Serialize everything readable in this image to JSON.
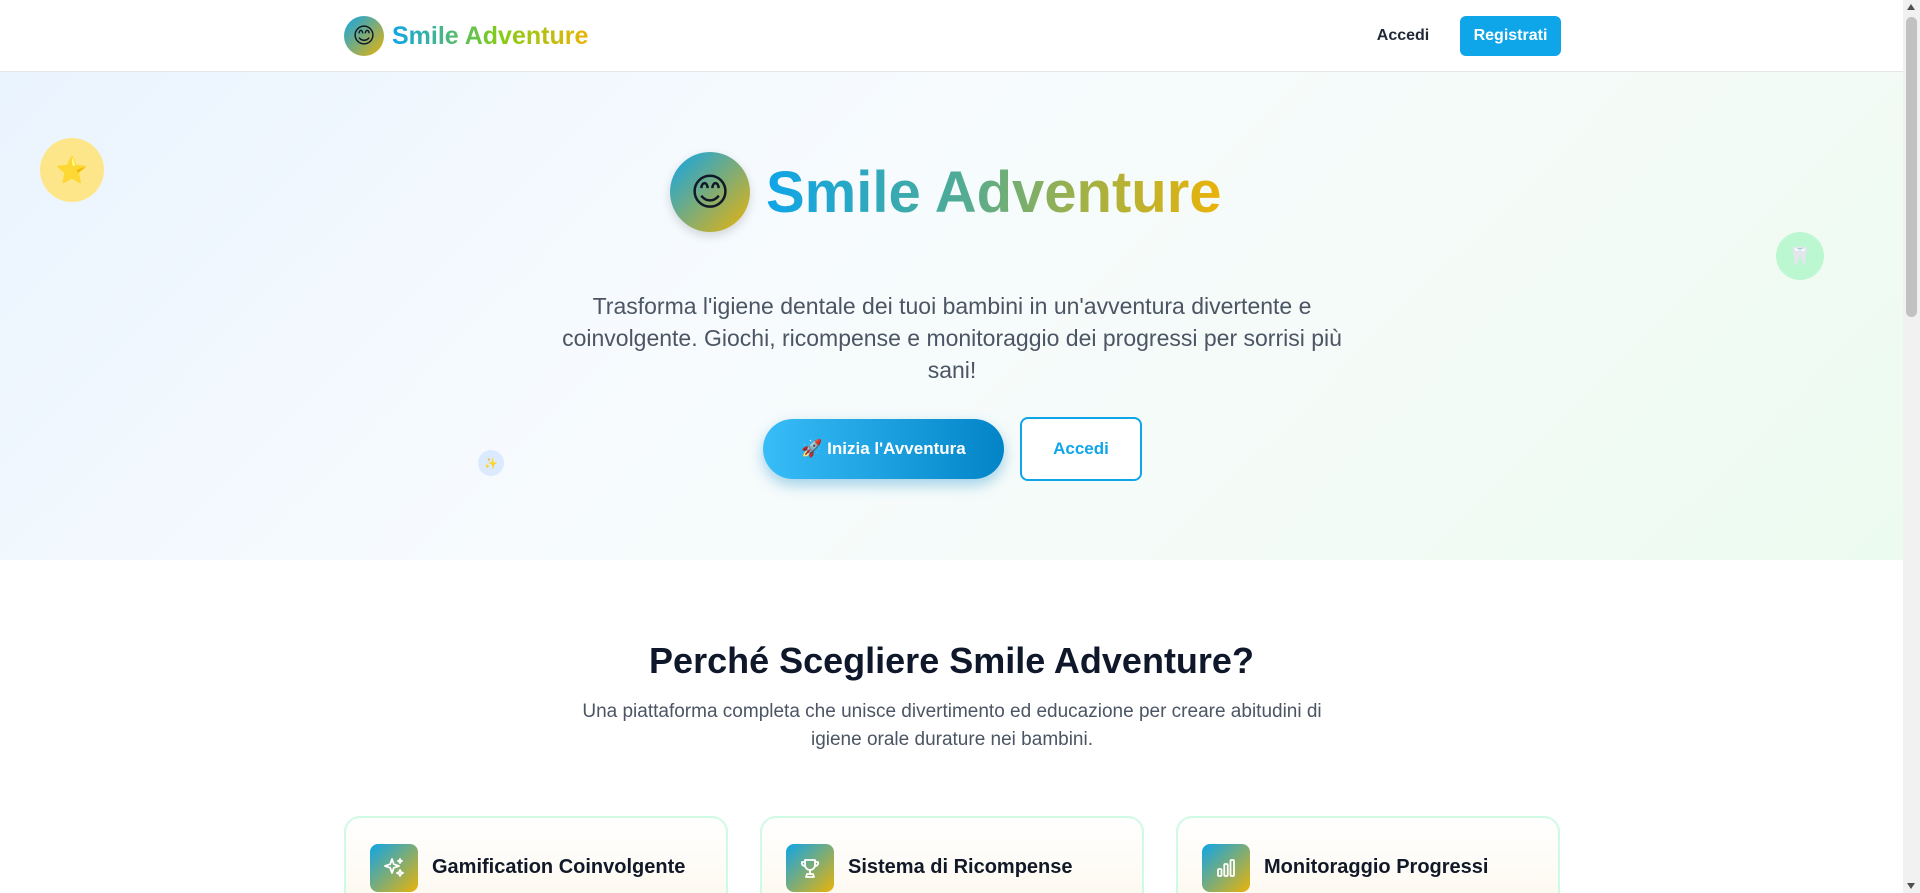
{
  "header": {
    "brand_emoji": "😊",
    "brand_name": "Smile Adventure",
    "login_label": "Accedi",
    "register_label": "Registrati"
  },
  "hero": {
    "logo_emoji": "😊",
    "title": "Smile Adventure",
    "description": "Trasforma l'igiene dentale dei tuoi bambini in un'avventura divertente e coinvolgente. Giochi, ricompense e monitoraggio dei progressi per sorrisi più sani!",
    "start_button": "🚀 Inizia l'Avventura",
    "login_button": "Accedi",
    "decor": {
      "star": "⭐",
      "tooth": "🦷",
      "sparkle": "✨"
    }
  },
  "features": {
    "title": "Perché Scegliere Smile Adventure?",
    "subtitle": "Una piattaforma completa che unisce divertimento ed educazione per creare abitudini di igiene orale durature nei bambini.",
    "cards": [
      {
        "icon": "sparkles-icon",
        "title": "Gamification Coinvolgente"
      },
      {
        "icon": "trophy-icon",
        "title": "Sistema di Ricompense"
      },
      {
        "icon": "bar-chart-icon",
        "title": "Monitoraggio Progressi"
      }
    ]
  },
  "colors": {
    "primary": "#0ea5e9",
    "accent": "#eab308",
    "heading": "#0f172a",
    "text_muted": "#4b5563"
  }
}
